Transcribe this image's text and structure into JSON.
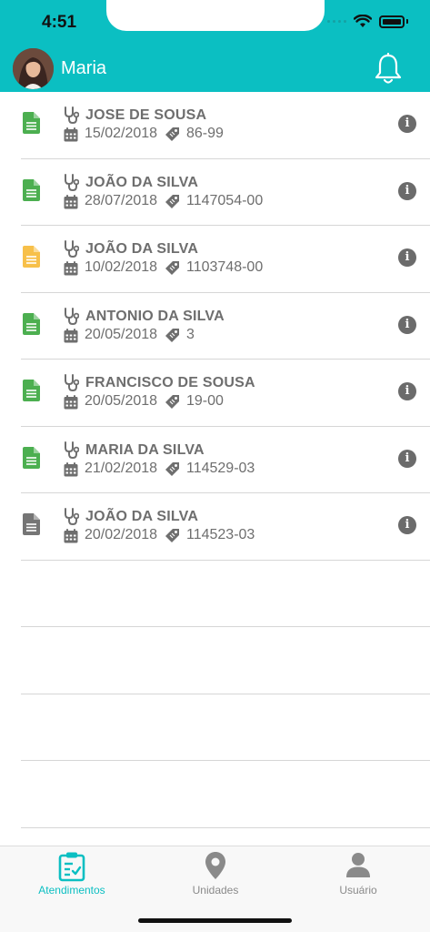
{
  "status_bar": {
    "time": "4:51"
  },
  "header": {
    "user_name": "Maria",
    "bell_icon": "bell-icon",
    "avatar_icon": "avatar"
  },
  "colors": {
    "accent": "#0bbfc2",
    "doc_green": "#4caf50",
    "doc_yellow": "#f7c04a",
    "doc_gray": "#757575",
    "text_gray": "#6e6e6e"
  },
  "appointments": [
    {
      "patient": "JOSE DE SOUSA",
      "date": "15/02/2018",
      "code": "86-99",
      "status_color": "green"
    },
    {
      "patient": "JOÃO DA SILVA",
      "date": "28/07/2018",
      "code": "1147054-00",
      "status_color": "green"
    },
    {
      "patient": "JOÃO DA SILVA",
      "date": "10/02/2018",
      "code": "1103748-00",
      "status_color": "yellow"
    },
    {
      "patient": "ANTONIO DA SILVA",
      "date": "20/05/2018",
      "code": "3",
      "status_color": "green"
    },
    {
      "patient": "FRANCISCO DE SOUSA",
      "date": "20/05/2018",
      "code": "19-00",
      "status_color": "green"
    },
    {
      "patient": "MARIA DA SILVA",
      "date": "21/02/2018",
      "code": "114529-03",
      "status_color": "green"
    },
    {
      "patient": "JOÃO DA SILVA",
      "date": "20/02/2018",
      "code": "114523-03",
      "status_color": "gray"
    }
  ],
  "tabs": [
    {
      "label": "Atendimentos",
      "icon": "clipboard-check-icon",
      "active": true
    },
    {
      "label": "Unidades",
      "icon": "map-pin-icon",
      "active": false
    },
    {
      "label": "Usuário",
      "icon": "user-icon",
      "active": false
    }
  ]
}
